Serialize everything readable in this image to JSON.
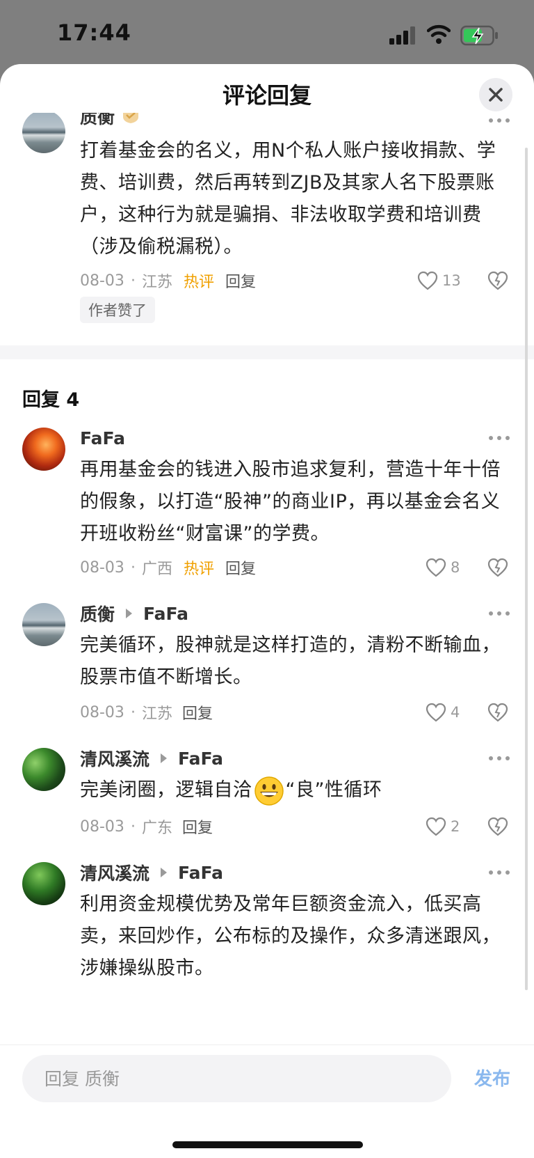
{
  "status_bar": {
    "time": "17:44"
  },
  "sheet": {
    "title": "评论回复",
    "close_icon": "close-icon"
  },
  "colors": {
    "hot": "#f0a000",
    "publish": "#8ab8ee",
    "meta": "#9a9a9a"
  },
  "parent_comment": {
    "author": "质衡",
    "text": "打着基金会的名义，用N个私人账户接收捐款、学费、培训费，然后再转到ZJB及其家人名下股票账户，这种行为就是骗捐、非法收取学费和培训费（涉及偷税漏税）。",
    "date": "08-03",
    "location": "江苏",
    "hot_label": "热评",
    "reply_label": "回复",
    "likes": "13",
    "author_liked": "作者赞了"
  },
  "replies_header": "回复 4",
  "replies": [
    {
      "author": "FaFa",
      "reply_to": "",
      "text": "再用基金会的钱进入股市追求复利，营造十年十倍的假象，以打造“股神”的商业IP，再以基金会名义开班收粉丝“财富课”的学费。",
      "date": "08-03",
      "location": "广西",
      "hot_label": "热评",
      "reply_label": "回复",
      "likes": "8"
    },
    {
      "author": "质衡",
      "reply_to": "FaFa",
      "text": "完美循环，股神就是这样打造的，清粉不断输血，股票市值不断增长。",
      "date": "08-03",
      "location": "江苏",
      "reply_label": "回复",
      "likes": "4"
    },
    {
      "author": "清风溪流",
      "reply_to": "FaFa",
      "text_before": "完美闭圈，逻辑自洽",
      "text_after": "“良”性循环",
      "date": "08-03",
      "location": "广东",
      "reply_label": "回复",
      "likes": "2"
    },
    {
      "author": "清风溪流",
      "reply_to": "FaFa",
      "text": "利用资金规模优势及常年巨额资金流入，低买高卖，来回炒作，公布标的及操作，众多清迷跟风，涉嫌操纵股市。"
    }
  ],
  "input": {
    "placeholder": "回复 质衡"
  },
  "publish_label": "发布",
  "dot": "·"
}
